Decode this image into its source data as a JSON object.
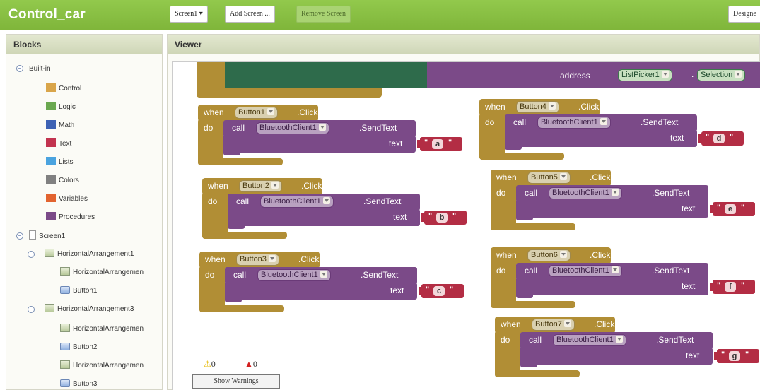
{
  "app_title": "Control_car",
  "toolbar": {
    "screen_select": "Screen1 ▾",
    "add_screen": "Add Screen ...",
    "remove_screen": "Remove Screen",
    "designer": "Designe"
  },
  "blocks_panel": {
    "title": "Blocks",
    "builtin_label": "Built-in",
    "builtin_items": [
      {
        "label": "Control",
        "color": "#d9a54a"
      },
      {
        "label": "Logic",
        "color": "#6aa84f"
      },
      {
        "label": "Math",
        "color": "#3d62b4"
      },
      {
        "label": "Text",
        "color": "#c2334f"
      },
      {
        "label": "Lists",
        "color": "#4aa3df"
      },
      {
        "label": "Colors",
        "color": "#808080"
      },
      {
        "label": "Variables",
        "color": "#e2632f"
      },
      {
        "label": "Procedures",
        "color": "#7b4a88"
      }
    ],
    "screen_label": "Screen1",
    "components": [
      {
        "label": "HorizontalArrangement1"
      },
      {
        "label": "HorizontalArrangemen"
      },
      {
        "label": "Button1"
      },
      {
        "label": "HorizontalArrangement3"
      },
      {
        "label": "HorizontalArrangemen"
      },
      {
        "label": "Button2"
      },
      {
        "label": "HorizontalArrangemen"
      },
      {
        "label": "Button3"
      }
    ]
  },
  "viewer": {
    "title": "Viewer",
    "top_block": {
      "address_label": "address",
      "listpicker": "ListPicker1",
      "dot": ".",
      "selection": "Selection"
    },
    "blocks": [
      {
        "button": "Button1",
        "char": "a"
      },
      {
        "button": "Button2",
        "char": "b"
      },
      {
        "button": "Button3",
        "char": "c"
      },
      {
        "button": "Button4",
        "char": "d"
      },
      {
        "button": "Button5",
        "char": "e"
      },
      {
        "button": "Button6",
        "char": "f"
      },
      {
        "button": "Button7",
        "char": "g"
      }
    ],
    "labels": {
      "when": "when",
      "click": ".Click",
      "do": "do",
      "call": "call",
      "client": "BluetoothClient1",
      "sendtext": ".SendText",
      "text": "text"
    },
    "warnings_count": "0",
    "errors_count": "0",
    "show_warnings": "Show Warnings"
  }
}
